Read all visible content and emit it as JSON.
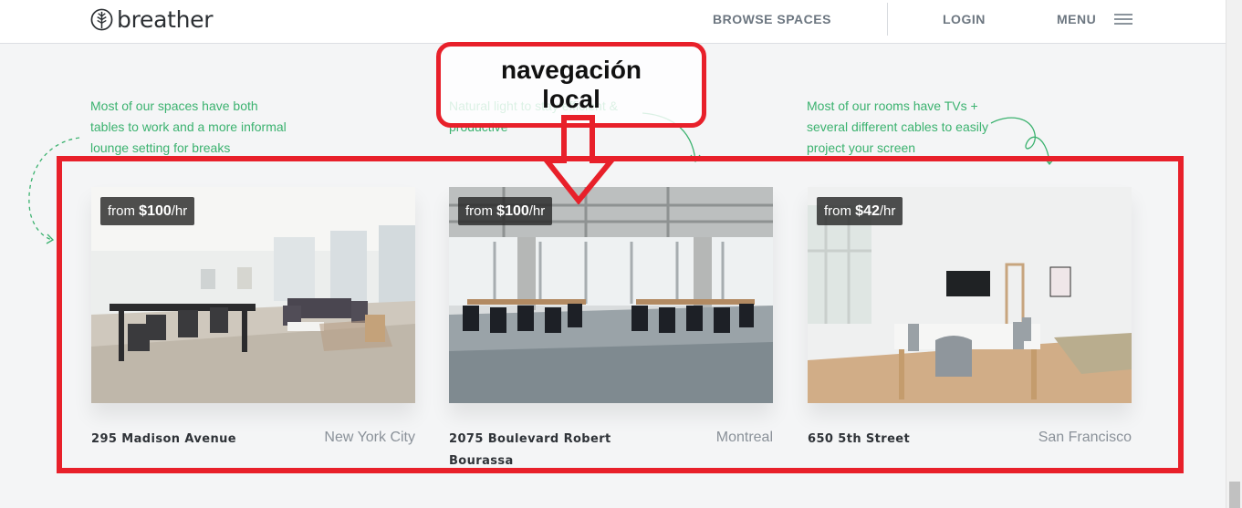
{
  "header": {
    "logo_text": "breather",
    "nav": {
      "browse": "BROWSE SPACES",
      "login": "LOGIN",
      "menu": "MENU"
    }
  },
  "tips": [
    {
      "text": "Most of our spaces have both tables to work and a more informal lounge setting for breaks"
    },
    {
      "text": "Natural light to stay efficient & productive"
    },
    {
      "text": "Most of our rooms have TVs + several different cables to easily project your screen"
    }
  ],
  "spaces": [
    {
      "price_prefix": "from ",
      "price": "$100",
      "price_suffix": "/hr",
      "address": "295 Madison Avenue",
      "city": "New York City"
    },
    {
      "price_prefix": "from ",
      "price": "$100",
      "price_suffix": "/hr",
      "address": "2075 Boulevard Robert Bourassa",
      "city": "Montreal"
    },
    {
      "price_prefix": "from ",
      "price": "$42",
      "price_suffix": "/hr",
      "address": "650 5th Street",
      "city": "San Francisco"
    }
  ],
  "annotation": {
    "label_line1": "navegación",
    "label_line2": "local",
    "color": "#e8202a"
  },
  "colors": {
    "tip_green": "#3bb26f",
    "nav_gray": "#6c7680"
  }
}
